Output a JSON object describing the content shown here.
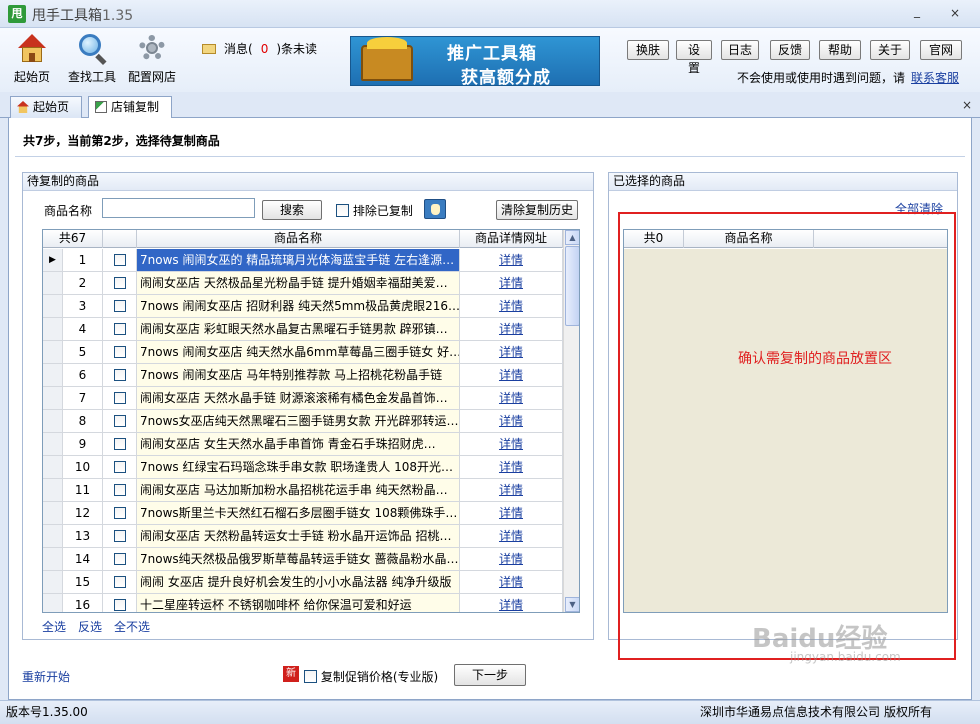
{
  "window": {
    "logo_char": "甩",
    "title": "甩手工具箱",
    "version": "1.35"
  },
  "toolbar": {
    "items": [
      {
        "label": "起始页"
      },
      {
        "label": "查找工具"
      },
      {
        "label": "配置网店"
      }
    ],
    "message": {
      "prefix": "消息(",
      "count": "0",
      "suffix": ")条未读"
    },
    "banner": {
      "line1": "推广工具箱",
      "line2": "获高额分成"
    },
    "buttons": [
      "换肤",
      "设置",
      "日志",
      "反馈",
      "帮助",
      "关于",
      "官网"
    ],
    "help_text": "不会使用或使用时遇到问题，请",
    "help_link": "联系客服"
  },
  "tabs": [
    {
      "label": "起始页"
    },
    {
      "label": "店铺复制"
    }
  ],
  "tab_close": "×",
  "step_text": "共7步，当前第2步，选择待复制商品",
  "left_panel": {
    "title": "待复制的商品",
    "name_label": "商品名称",
    "name_value": "",
    "search_btn": "搜索",
    "exclude_label": "排除已复制",
    "clear_history_btn": "清除复制历史",
    "table": {
      "headers": [
        "共67",
        "商品名称",
        "商品详情网址"
      ],
      "rows": [
        {
          "n": "1",
          "name": "7nows 闹闹女巫的 精品琉璃月光体海蓝宝手链 左右逢源…",
          "link": "详情"
        },
        {
          "n": "2",
          "name": "闹闹女巫店 天然极品星光粉晶手链 提升婚姻幸福甜美爱…",
          "link": "详情"
        },
        {
          "n": "3",
          "name": "7nows 闹闹女巫店 招财利器 纯天然5mm极品黄虎眼216…",
          "link": "详情"
        },
        {
          "n": "4",
          "name": "闹闹女巫店 彩虹眼天然水晶复古黑曜石手链男款 辟邪镇…",
          "link": "详情"
        },
        {
          "n": "5",
          "name": "7nows 闹闹女巫店 纯天然水晶6mm草莓晶三圈手链女 好…",
          "link": "详情"
        },
        {
          "n": "6",
          "name": "7nows 闹闹女巫店 马年特别推荐款 马上招桃花粉晶手链",
          "link": "详情"
        },
        {
          "n": "7",
          "name": "闹闹女巫店 天然水晶手链 财源滚滚稀有橘色金发晶首饰…",
          "link": "详情"
        },
        {
          "n": "8",
          "name": "7nows女巫店纯天然黑曜石三圈手链男女款 开光辟邪转运…",
          "link": "详情"
        },
        {
          "n": "9",
          "name": "闹闹女巫店 女生天然水晶手串首饰 青金石手珠招财虎…",
          "link": "详情"
        },
        {
          "n": "10",
          "name": "7nows 红绿宝石玛瑙念珠手串女款 职场逢贵人 108开光…",
          "link": "详情"
        },
        {
          "n": "11",
          "name": "闹闹女巫店 马达加斯加粉水晶招桃花运手串 纯天然粉晶…",
          "link": "详情"
        },
        {
          "n": "12",
          "name": "7nows斯里兰卡天然红石榴石多层圈手链女 108颗佛珠手…",
          "link": "详情"
        },
        {
          "n": "13",
          "name": "闹闹女巫店 天然粉晶转运女士手链 粉水晶开运饰品 招桃…",
          "link": "详情"
        },
        {
          "n": "14",
          "name": "7nows纯天然极品俄罗斯草莓晶转运手链女 蔷薇晶粉水晶…",
          "link": "详情"
        },
        {
          "n": "15",
          "name": "闹闹 女巫店 提升良好机会发生的小小水晶法器 纯净升级版",
          "link": "详情"
        },
        {
          "n": "16",
          "name": "十二星座转运杯 不锈钢咖啡杯 给你保温可爱和好运",
          "link": "详情"
        }
      ]
    },
    "select_all": "全选",
    "invert": "反选",
    "select_none": "全不选"
  },
  "right_panel": {
    "title": "已选择的商品",
    "clear_all": "全部清除",
    "headers": [
      "共0",
      "商品名称"
    ],
    "drop_hint": "确认需复制的商品放置区"
  },
  "footer": {
    "restart": "重新开始",
    "new_badge": "新",
    "copy_promo_label": "复制促销价格(专业版)",
    "next_btn": "下一步"
  },
  "status": {
    "version": "版本号1.35.00",
    "company": "深圳市华通易点信息技术有限公司",
    "rights": "版权所有"
  },
  "watermark": {
    "line1": "Baidu经验",
    "line2": "jingyan.baidu.com"
  }
}
